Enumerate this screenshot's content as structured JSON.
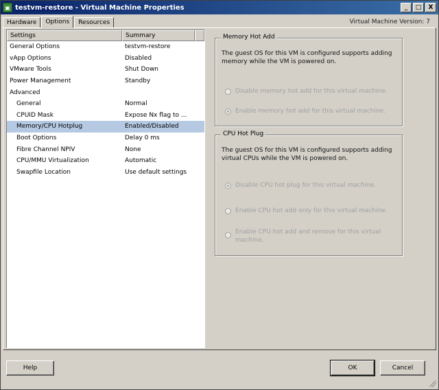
{
  "window": {
    "vm_name": "testvm-restore",
    "title_suffix": " - Virtual Machine Properties",
    "minimize": "_",
    "maximize": "□",
    "close": "X"
  },
  "tabs": [
    "Hardware",
    "Options",
    "Resources"
  ],
  "vm_version": "Virtual Machine Version: 7",
  "list": {
    "headers": {
      "settings": "Settings",
      "summary": "Summary"
    },
    "rows": [
      {
        "setting": "General Options",
        "summary": "testvm-restore"
      },
      {
        "setting": "vApp Options",
        "summary": "Disabled"
      },
      {
        "setting": "VMware Tools",
        "summary": "Shut Down"
      },
      {
        "setting": "Power Management",
        "summary": "Standby"
      },
      {
        "setting": "Advanced",
        "summary": ""
      },
      {
        "setting": "General",
        "summary": "Normal"
      },
      {
        "setting": "CPUID Mask",
        "summary": "Expose Nx flag to ..."
      },
      {
        "setting": "Memory/CPU Hotplug",
        "summary": "Enabled/Disabled"
      },
      {
        "setting": "Boot Options",
        "summary": "Delay 0 ms"
      },
      {
        "setting": "Fibre Channel NPIV",
        "summary": "None"
      },
      {
        "setting": "CPU/MMU Virtualization",
        "summary": "Automatic"
      },
      {
        "setting": "Swapfile Location",
        "summary": "Use default settings"
      }
    ]
  },
  "memory_hot_add": {
    "title": "Memory Hot Add",
    "description": "The guest OS for this VM is configured supports adding memory while the VM is powered on.",
    "options": [
      "Disable memory hot add for this virtual machine.",
      "Enable memory hot add for this virtual machine."
    ],
    "selected": 1
  },
  "cpu_hot_plug": {
    "title": "CPU Hot Plug",
    "description": "The guest OS for this VM is configured supports adding virtual CPUs while the VM is powered on.",
    "options": [
      "Disable CPU hot plug for this virtual machine.",
      "Enable CPU hot add only for this virtual machine.",
      "Enable CPU hot add and remove for this virtual machine."
    ],
    "selected": 0
  },
  "buttons": {
    "help": "Help",
    "ok": "OK",
    "cancel": "Cancel"
  }
}
